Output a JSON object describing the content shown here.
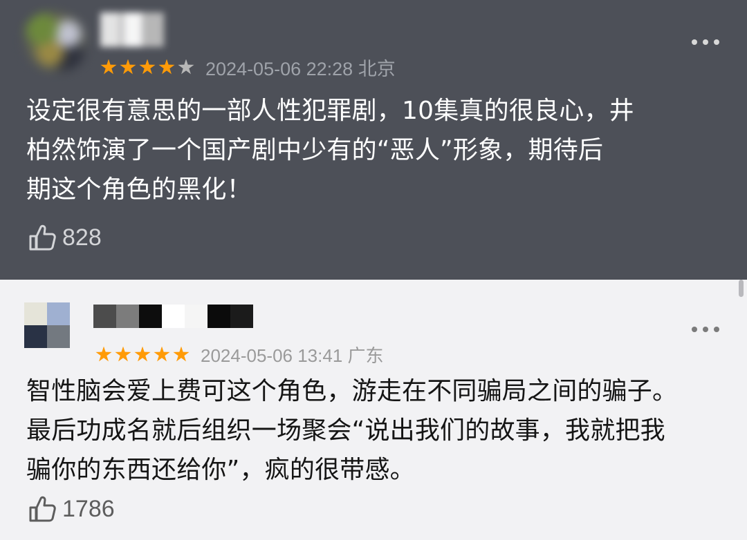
{
  "theme": {
    "dark_card": "#4d5058",
    "light_card": "#f2f2f4",
    "star_active": "#ff9b08",
    "star_inactive": "#b7b7b7"
  },
  "reviews": [
    {
      "rating": 4,
      "max_rating": 5,
      "datetime": "2024-05-06 22:28",
      "location": "北京",
      "text": "设定很有意思的一部人性犯罪剧，10集真的很良心，井\n柏然饰演了一个国产剧中少有的“恶人”形象，期待后\n期这个角色的黑化！",
      "likes": "828",
      "icons": {
        "more": "more-icon",
        "like": "thumbs-up-icon"
      }
    },
    {
      "rating": 5,
      "max_rating": 5,
      "datetime": "2024-05-06 13:41",
      "location": "广东",
      "text": "智性脑会爱上费可这个角色，游走在不同骗局之间的骗子。\n最后功成名就后组织一场聚会“说出我们的故事，我就把我\n骗你的东西还给你”，疯的很带感。",
      "likes": "1786",
      "icons": {
        "more": "more-icon",
        "like": "thumbs-up-icon"
      }
    }
  ]
}
